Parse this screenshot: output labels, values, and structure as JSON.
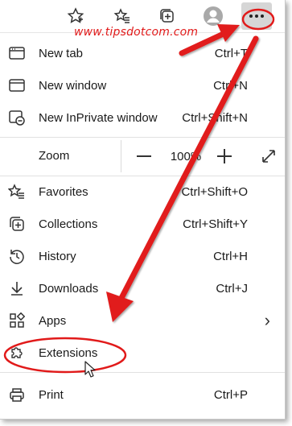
{
  "watermark": "www.tipsdotcom.com",
  "toolbar": {
    "icons": [
      "favorites-add-icon",
      "favorites-icon",
      "collections-icon",
      "profile-icon",
      "more-options-icon"
    ]
  },
  "menu": {
    "new_tab": {
      "label": "New tab",
      "shortcut": "Ctrl+T"
    },
    "new_window": {
      "label": "New window",
      "shortcut": "Ctrl+N"
    },
    "new_inprivate": {
      "label": "New InPrivate window",
      "shortcut": "Ctrl+Shift+N"
    },
    "zoom": {
      "label": "Zoom",
      "value": "100%",
      "minus": "—",
      "plus": "+"
    },
    "favorites": {
      "label": "Favorites",
      "shortcut": "Ctrl+Shift+O"
    },
    "collections": {
      "label": "Collections",
      "shortcut": "Ctrl+Shift+Y"
    },
    "history": {
      "label": "History",
      "shortcut": "Ctrl+H"
    },
    "downloads": {
      "label": "Downloads",
      "shortcut": "Ctrl+J"
    },
    "apps": {
      "label": "Apps",
      "chevron": "›"
    },
    "extensions": {
      "label": "Extensions"
    },
    "print": {
      "label": "Print",
      "shortcut": "Ctrl+P"
    }
  },
  "colors": {
    "annotation_red": "#e11a1a",
    "selected_bg": "#d6d6d6"
  }
}
